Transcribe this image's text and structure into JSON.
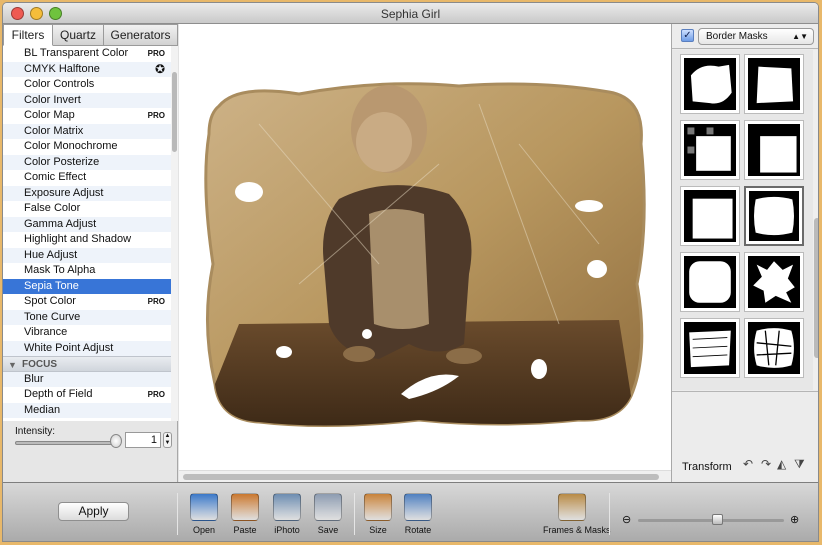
{
  "window": {
    "title": "Sephia Girl",
    "colors": {
      "close": "#ee5a52",
      "minimize": "#f5bd3a",
      "zoom": "#6fc33d"
    }
  },
  "tabs": [
    {
      "label": "Filters",
      "selected": true
    },
    {
      "label": "Quartz",
      "selected": false
    },
    {
      "label": "Generators",
      "selected": false
    }
  ],
  "filters": [
    {
      "label": "BL Transparent Color",
      "badge": "PRO"
    },
    {
      "label": "CMYK Halftone",
      "icon": "settings-icon"
    },
    {
      "label": "Color Controls"
    },
    {
      "label": "Color Invert"
    },
    {
      "label": "Color Map",
      "badge": "PRO"
    },
    {
      "label": "Color Matrix"
    },
    {
      "label": "Color Monochrome"
    },
    {
      "label": "Color Posterize"
    },
    {
      "label": "Comic Effect"
    },
    {
      "label": "Exposure Adjust"
    },
    {
      "label": "False Color"
    },
    {
      "label": "Gamma Adjust"
    },
    {
      "label": "Highlight and Shadow"
    },
    {
      "label": "Hue Adjust"
    },
    {
      "label": "Mask To Alpha"
    },
    {
      "label": "Sepia Tone",
      "selected": true
    },
    {
      "label": "Spot Color",
      "badge": "PRO"
    },
    {
      "label": "Tone Curve"
    },
    {
      "label": "Vibrance"
    },
    {
      "label": "White Point Adjust"
    },
    {
      "label": "FOCUS",
      "group": true
    },
    {
      "label": "Blur"
    },
    {
      "label": "Depth of Field",
      "badge": "PRO"
    },
    {
      "label": "Median"
    }
  ],
  "intensity": {
    "label": "Intensity:",
    "value": "1",
    "level": 1.0
  },
  "masks_panel": {
    "enabled": true,
    "dropdown": "Border Masks",
    "selected_index": 5,
    "count": 10
  },
  "transform": {
    "label": "Transform",
    "icons": [
      "rotate-left-icon",
      "rotate-right-icon",
      "flip-horizontal-icon",
      "flip-vertical-icon"
    ]
  },
  "toolbar": {
    "apply": "Apply",
    "buttons": [
      {
        "label": "Open",
        "icon": "open-icon",
        "color": "#3b78c8"
      },
      {
        "label": "Paste",
        "icon": "paste-icon",
        "color": "#c9772e"
      },
      {
        "label": "iPhoto",
        "icon": "iphoto-icon",
        "color": "#6c8cb0"
      },
      {
        "label": "Save",
        "icon": "save-icon",
        "color": "#8c9bb0"
      },
      {
        "label": "Size",
        "icon": "size-icon",
        "color": "#c8823a"
      },
      {
        "label": "Rotate",
        "icon": "rotate-icon",
        "color": "#4f7fbf"
      },
      {
        "label": "Frames & Masks",
        "icon": "frames-icon",
        "color": "#b88a45"
      }
    ],
    "zoom_level": 0.55
  },
  "image": {
    "description_colors": {
      "sepia_light": "#d8c29a",
      "sepia_dark": "#5a4126"
    }
  }
}
